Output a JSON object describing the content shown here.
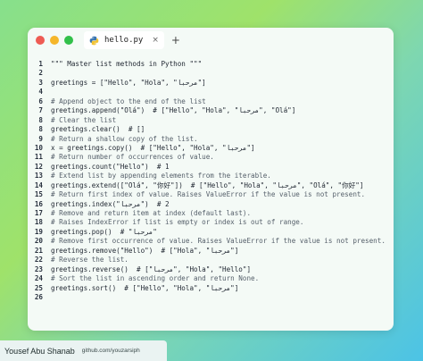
{
  "window": {
    "tab_label": "hello.py",
    "tab_close": "×",
    "tab_add": "+"
  },
  "code_lines": [
    {
      "n": "1",
      "text": "\"\"\" Master list methods in Python \"\"\"",
      "kind": "code"
    },
    {
      "n": "2",
      "text": "",
      "kind": "code"
    },
    {
      "n": "3",
      "text": "greetings = [\"Hello\", \"Hola\", \"مرحبا\"]",
      "kind": "code"
    },
    {
      "n": "4",
      "text": "",
      "kind": "code"
    },
    {
      "n": "6",
      "text": "# Append object to the end of the list",
      "kind": "comment"
    },
    {
      "n": "7",
      "text": "greetings.append(\"Olá\")  # [\"Hello\", \"Hola\", \"مرحبا\", \"Olá\"]",
      "kind": "code"
    },
    {
      "n": "8",
      "text": "# Clear the list",
      "kind": "comment"
    },
    {
      "n": "8",
      "text": "greetings.clear()  # []",
      "kind": "code"
    },
    {
      "n": "9",
      "text": "# Return a shallow copy of the list.",
      "kind": "comment"
    },
    {
      "n": "10",
      "text": "x = greetings.copy()  # [\"Hello\", \"Hola\", \"مرحبا\"]",
      "kind": "code"
    },
    {
      "n": "11",
      "text": "# Return number of occurrences of value.",
      "kind": "comment"
    },
    {
      "n": "12",
      "text": "greetings.count(\"Hello\")  # 1",
      "kind": "code"
    },
    {
      "n": "13",
      "text": "# Extend list by appending elements from the iterable.",
      "kind": "comment"
    },
    {
      "n": "14",
      "text": "greetings.extend([\"Olá\", \"你好\"])  # [\"Hello\", \"Hola\", \"مرحبا\", \"Olá\", \"你好\"]",
      "kind": "code"
    },
    {
      "n": "15",
      "text": "# Return first index of value. Raises ValueError if the value is not present.",
      "kind": "comment"
    },
    {
      "n": "16",
      "text": "greetings.index(\"مرحبا\")  # 2",
      "kind": "code"
    },
    {
      "n": "17",
      "text": "# Remove and return item at index (default last).",
      "kind": "comment"
    },
    {
      "n": "18",
      "text": "# Raises IndexError if list is empty or index is out of range.",
      "kind": "comment"
    },
    {
      "n": "19",
      "text": "greetings.pop()  # \"مرحبا\"",
      "kind": "code"
    },
    {
      "n": "20",
      "text": "# Remove first occurrence of value. Raises ValueError if the value is not present.",
      "kind": "comment"
    },
    {
      "n": "21",
      "text": "greetings.remove(\"Hello\")  # [\"Hola\", \"مرحبا\"]",
      "kind": "code"
    },
    {
      "n": "22",
      "text": "# Reverse the list.",
      "kind": "comment"
    },
    {
      "n": "23",
      "text": "greetings.reverse()  # [\"مرحبا\", \"Hola\", \"Hello\"]",
      "kind": "code"
    },
    {
      "n": "24",
      "text": "# Sort the list in ascending order and return None.",
      "kind": "comment"
    },
    {
      "n": "25",
      "text": "greetings.sort()  # [\"Hello\", \"Hola\", \"مرحبا\"]",
      "kind": "code"
    },
    {
      "n": "26",
      "text": "",
      "kind": "code"
    }
  ],
  "footer": {
    "author": "Yousef Abu Shanab",
    "url": "github.com/youzarsiph"
  },
  "colors": {
    "close_dot": "#ee5b53",
    "minimize_dot": "#f5b62a",
    "maximize_dot": "#32c04a"
  }
}
